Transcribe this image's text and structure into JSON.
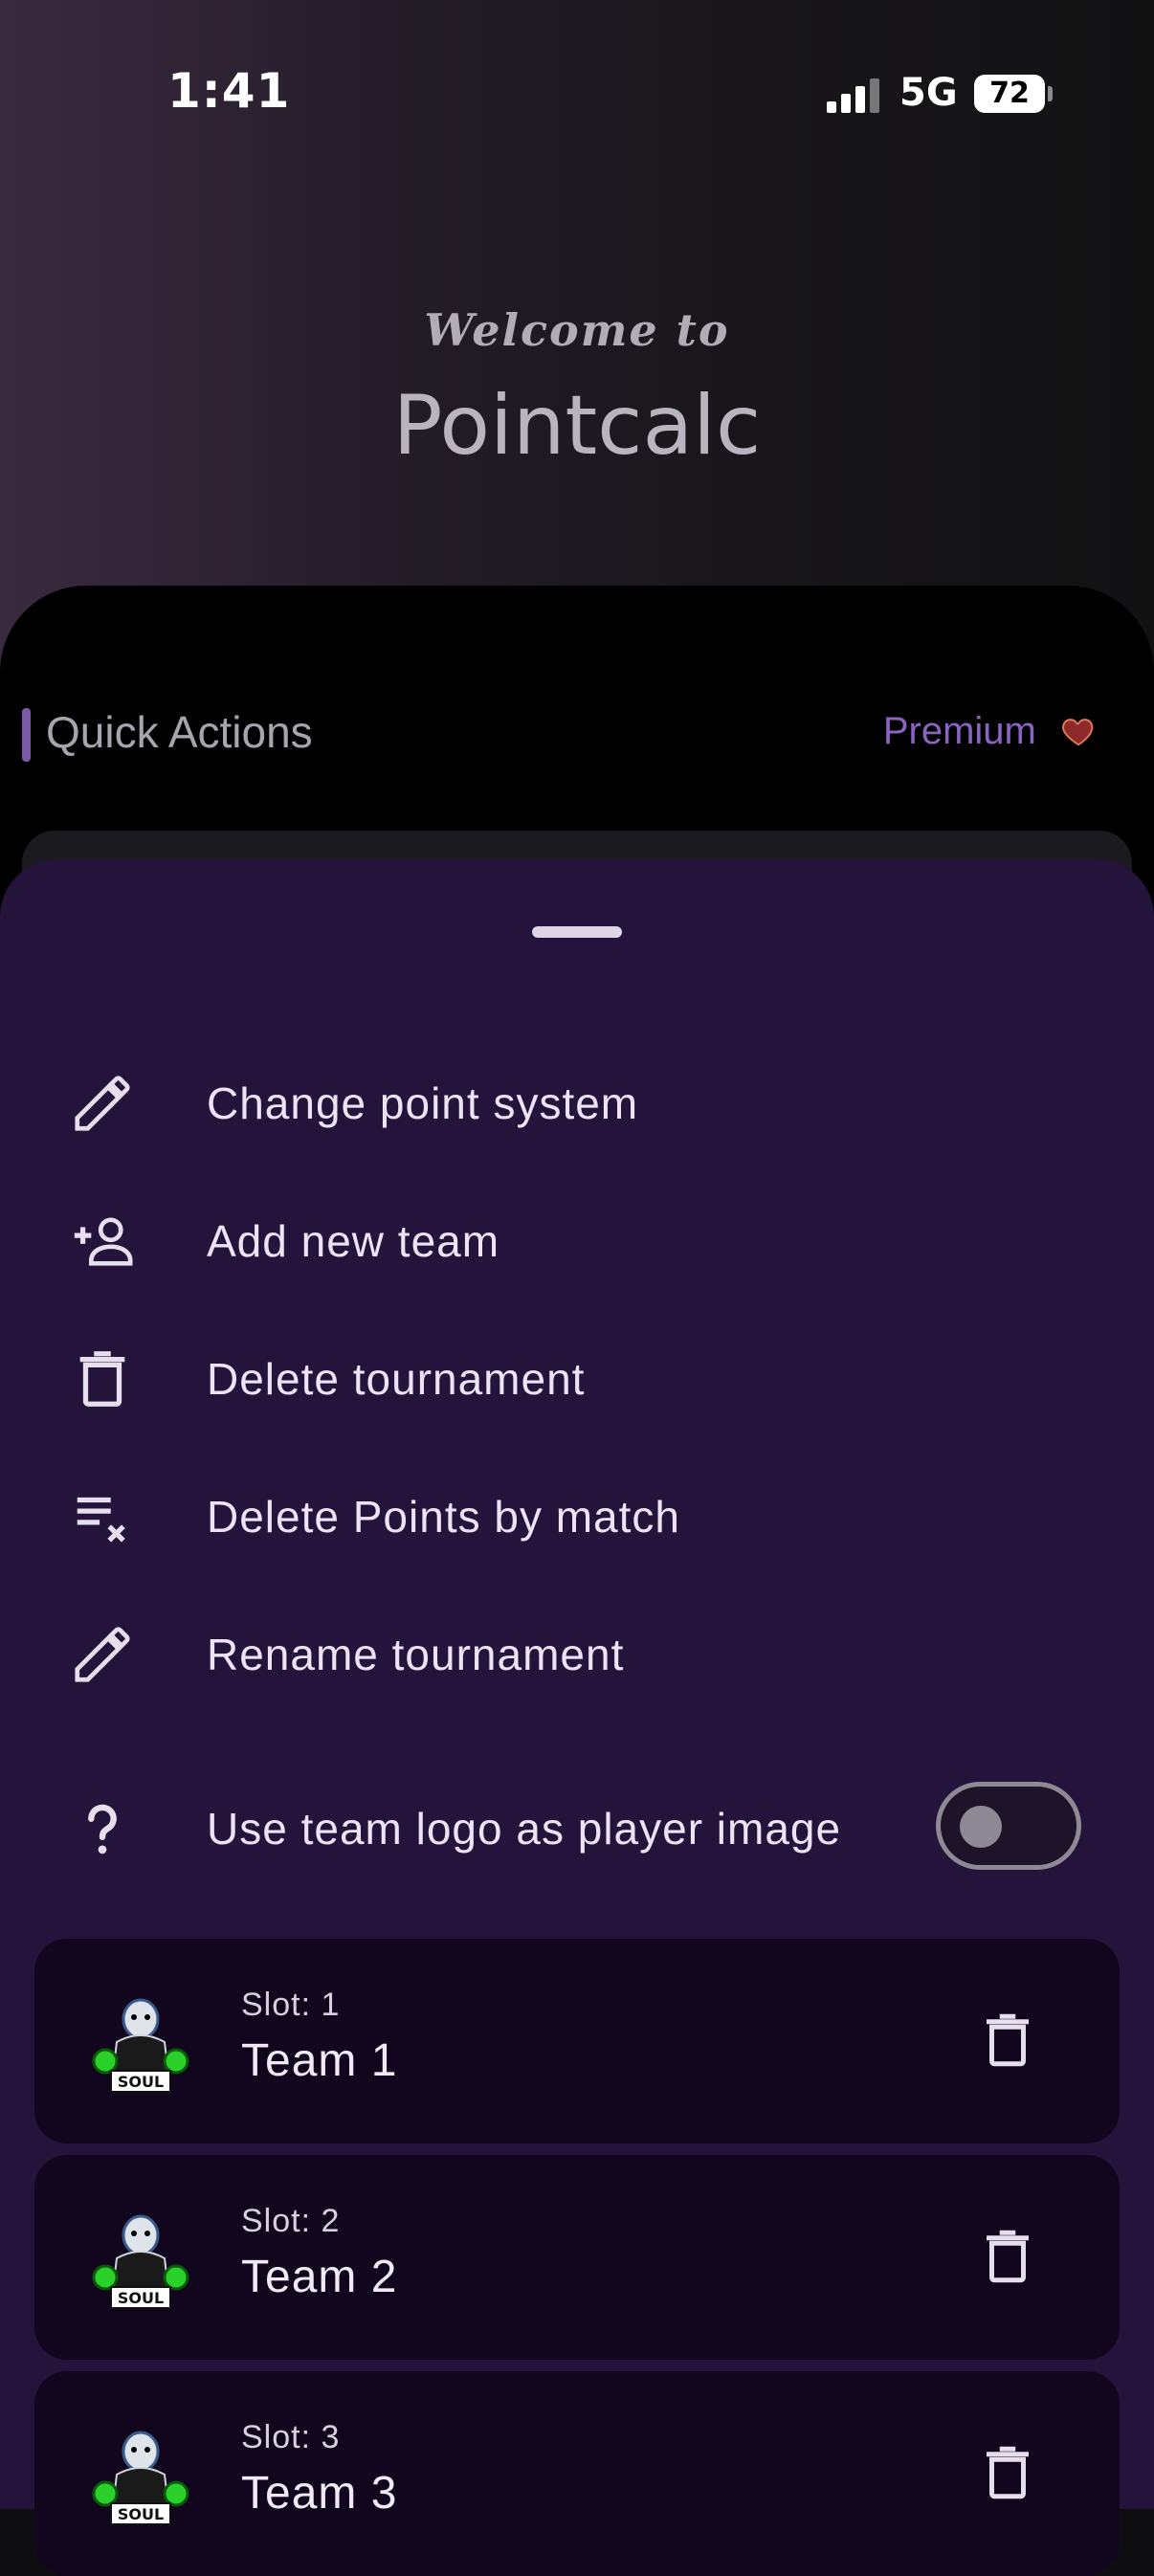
{
  "status": {
    "time": "1:41",
    "network": "5G",
    "battery": "72"
  },
  "header": {
    "welcome": "Welcome to",
    "title": "Pointcalc"
  },
  "quick_actions": {
    "title": "Quick Actions",
    "premium_label": "Premium",
    "premium_icon": "heart-icon"
  },
  "menu": [
    {
      "label": "Change point system",
      "icon": "pencil-icon"
    },
    {
      "label": "Add new team",
      "icon": "add-person-icon"
    },
    {
      "label": "Delete tournament",
      "icon": "trash-icon"
    },
    {
      "label": "Delete Points by match",
      "icon": "clear-list-icon"
    },
    {
      "label": "Rename tournament",
      "icon": "pencil-icon"
    }
  ],
  "toggle_option": {
    "label": "Use team logo as player image",
    "icon": "question-mark-icon",
    "enabled": false
  },
  "teams": [
    {
      "slot": "Slot: 1",
      "name": "Team 1",
      "logo": "soul-logo"
    },
    {
      "slot": "Slot: 2",
      "name": "Team 2",
      "logo": "soul-logo"
    },
    {
      "slot": "Slot: 3",
      "name": "Team 3",
      "logo": "soul-logo"
    }
  ],
  "colors": {
    "sheet": "#24133b",
    "accent": "#8b63c2",
    "card": "#12061e"
  }
}
